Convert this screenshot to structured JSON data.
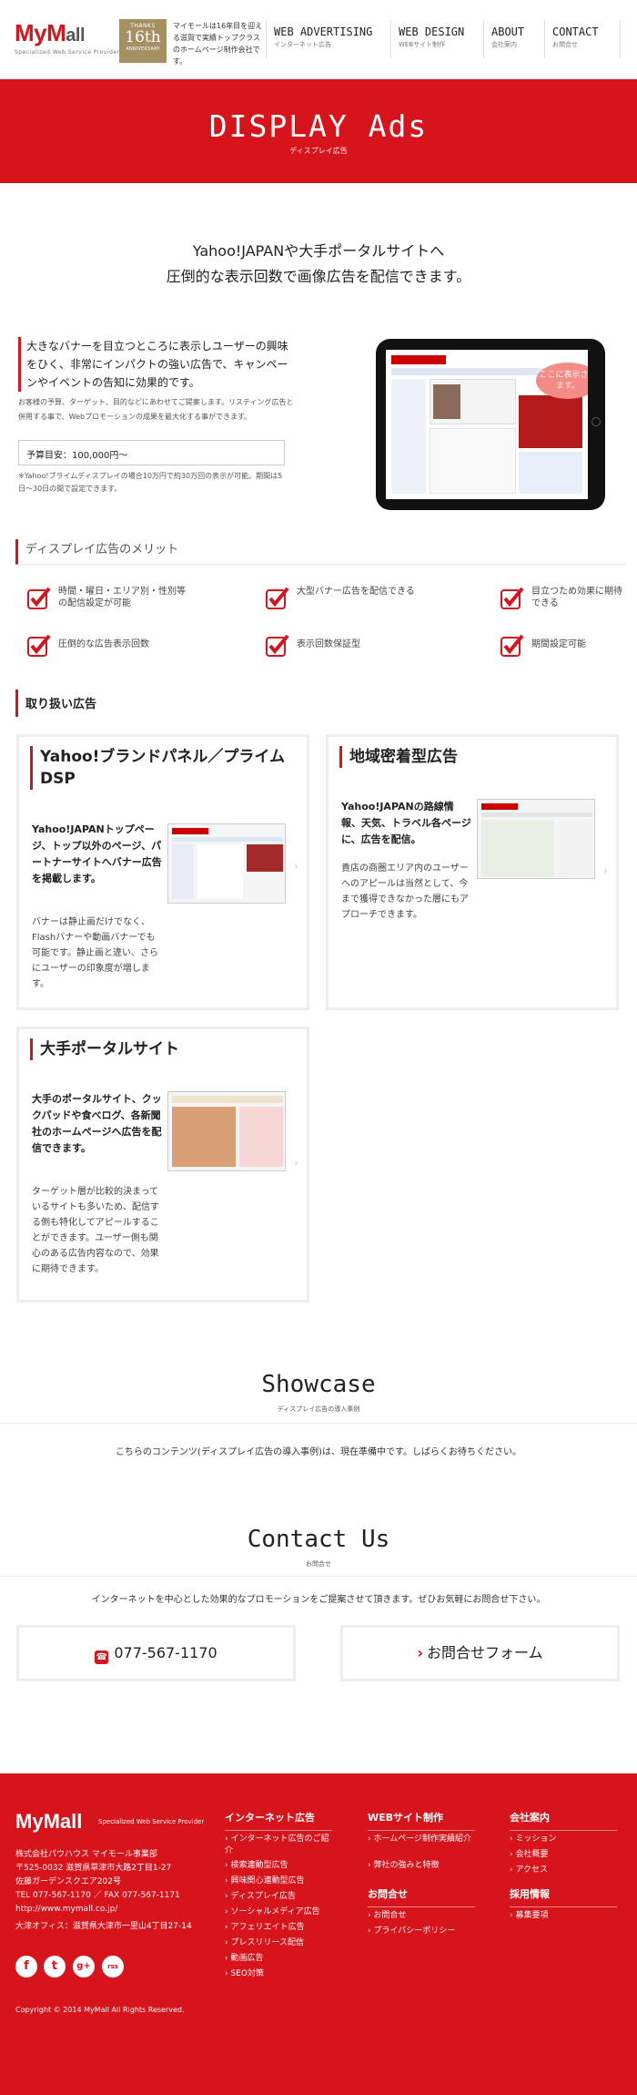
{
  "header": {
    "logo": {
      "prefix": "My",
      "middle": "M",
      "suffix": "all",
      "tagline": "Specialized Web Service Provider"
    },
    "badge": {
      "line1": "THANKS",
      "line2": "16th",
      "line3": "ANNIVERSARY"
    },
    "badge_text": "マイモールは16年目を迎える滋賀で実績トップクラスのホームページ制作会社です。",
    "nav": [
      {
        "en": "WEB ADVERTISING",
        "jp": "インターネット広告"
      },
      {
        "en": "WEB DESIGN",
        "jp": "WEBサイト制作"
      },
      {
        "en": "ABOUT",
        "jp": "会社案内"
      },
      {
        "en": "CONTACT",
        "jp": "お問合せ"
      }
    ]
  },
  "hero": {
    "title": "DISPLAY Ads",
    "subtitle": "ディスプレイ広告"
  },
  "lead": {
    "line1": "Yahoo!JAPANや大手ポータルサイトへ",
    "line2": "圧倒的な表示回数で画像広告を配信できます。"
  },
  "intro": {
    "headline": "大きなバナーを目立つところに表示しユーザーの興味をひく、非常にインパクトの強い広告で、キャンペーンやイベントの告知に効果的です。",
    "note": "お客様の予算、ターゲット、目的などにあわせてご提案します。リスティング広告と併用する事で、Webプロモーションの成果を最大化する事ができます。",
    "budget": "予算目安：100,000円〜",
    "budget_note": "※Yahoo!ブライムディスプレイの場合10万円で約30万回の表示が可能。期間は5日〜30日の間で設定できます。",
    "bubble": "ここに表示されます。"
  },
  "merits": {
    "heading": "ディスプレイ広告のメリット",
    "items": [
      "時間・曜日・エリア別・性別等の配信設定が可能",
      "大型バナー広告を配信できる",
      "目立つため効果に期待できる",
      "圧倒的な広告表示回数",
      "表示回数保証型",
      "期間設定可能"
    ]
  },
  "products": {
    "heading": "取り扱い広告",
    "cards": [
      {
        "title": "Yahoo!ブランドパネル／プライムDSP",
        "bold": "Yahoo!JAPANトップページ、トップ以外のページ、パートナーサイトへバナー広告を掲載します。",
        "desc": "バナーは静止画だけでなく、Flashバナーや動画バナーでも可能です。静止画と違い、さらにユーザーの印象度が増します。"
      },
      {
        "title": "地域密着型広告",
        "bold": "Yahoo!JAPANの路線情報、天気、トラベル各ページに、広告を配信。",
        "desc": "貴店の商圏エリア内のユーザーへのアピールは当然として、今まで獲得できなかった層にもアプローチできます。"
      },
      {
        "title": "大手ポータルサイト",
        "bold": "大手のポータルサイト、クックパッドや食べログ、各新聞社のホームページへ広告を配信できます。",
        "desc": "ターゲット層が比較的決まっているサイトも多いため、配信する側も特化してアピールすることができます。ユーザー側も関心のある広告内容なので、効果に期待できます。"
      }
    ]
  },
  "showcase": {
    "title": "Showcase",
    "subtitle": "ディスプレイ広告の導入事例",
    "note": "こちらのコンテンツ(ディスプレイ広告の導入事例)は、現在準備中です。しばらくお待ちください。"
  },
  "contact": {
    "title": "Contact Us",
    "subtitle": "お問合せ",
    "note": "インターネットを中心とした効果的なプロモーションをご提案させて頂きます。ぜひお気軽にお問合せ下さい。",
    "phone": "077-567-1170",
    "form": "お問合せフォーム"
  },
  "footer": {
    "logo_tagline": "Specialized Web Service Provider",
    "address": [
      "株式会社パウハウス マイモール事業部",
      "〒525-0032 滋賀県草津市大路2丁目1-27",
      "佐藤ガーデンスクエア202号",
      "TEL 077-567-1170 ／ FAX 077-567-1171",
      "http://www.mymall.co.jp/",
      "大津オフィス：滋賀県大津市一里山4丁目27-14"
    ],
    "sns": [
      "f",
      "t",
      "g+",
      "rss"
    ],
    "copyright": "Copyright © 2014 MyMall All Rights Reserved.",
    "col1": {
      "heading": "インターネット広告",
      "items": [
        "インターネット広告のご紹介",
        "検索連動型広告",
        "興味関心連動型広告",
        "ディスプレイ広告",
        "ソーシャルメディア広告",
        "アフェリエイト広告",
        "プレスリリース配信",
        "動画広告",
        "SEO対策"
      ]
    },
    "col2": {
      "heading": "WEBサイト制作",
      "items": [
        "ホームページ制作実績紹介",
        "弊社の強みと特徴"
      ],
      "heading2": "お問合せ",
      "items2": [
        "お問合せ",
        "プライバシーポリシー"
      ]
    },
    "col3": {
      "heading": "会社案内",
      "items": [
        "ミッション",
        "会社概要",
        "アクセス"
      ],
      "heading2": "採用情報",
      "items2": [
        "募集要項"
      ]
    }
  }
}
